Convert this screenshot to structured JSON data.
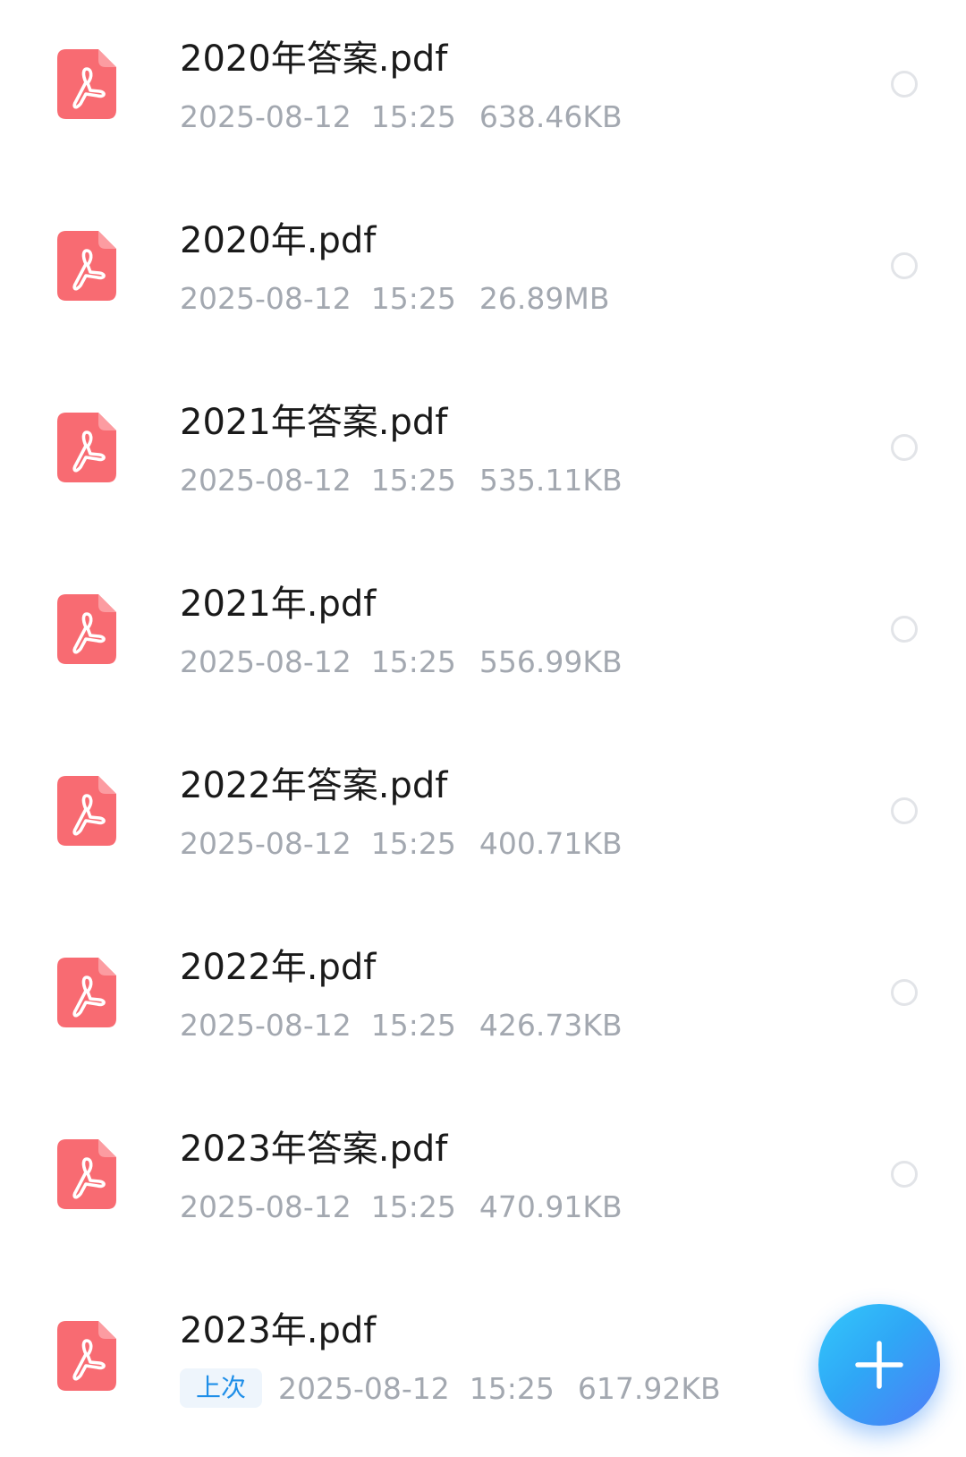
{
  "files": [
    {
      "name": "2020年答案.pdf",
      "date": "2025-08-12",
      "time": "15:25",
      "size": "638.46KB",
      "icon": "pdf-file-icon",
      "selected": false
    },
    {
      "name": "2020年.pdf",
      "date": "2025-08-12",
      "time": "15:25",
      "size": "26.89MB",
      "icon": "pdf-file-icon",
      "selected": false
    },
    {
      "name": "2021年答案.pdf",
      "date": "2025-08-12",
      "time": "15:25",
      "size": "535.11KB",
      "icon": "pdf-file-icon",
      "selected": false
    },
    {
      "name": "2021年.pdf",
      "date": "2025-08-12",
      "time": "15:25",
      "size": "556.99KB",
      "icon": "pdf-file-icon",
      "selected": false
    },
    {
      "name": "2022年答案.pdf",
      "date": "2025-08-12",
      "time": "15:25",
      "size": "400.71KB",
      "icon": "pdf-file-icon",
      "selected": false
    },
    {
      "name": "2022年.pdf",
      "date": "2025-08-12",
      "time": "15:25",
      "size": "426.73KB",
      "icon": "pdf-file-icon",
      "selected": false
    },
    {
      "name": "2023年答案.pdf",
      "date": "2025-08-12",
      "time": "15:25",
      "size": "470.91KB",
      "icon": "pdf-file-icon",
      "selected": false
    },
    {
      "name": "2023年.pdf",
      "badge": "上次",
      "date": "2025-08-12",
      "time": "15:25",
      "size": "617.92KB",
      "icon": "pdf-file-icon"
    }
  ],
  "fab": {
    "icon": "plus-icon"
  },
  "colors": {
    "pdf_icon": "#f86b72",
    "name_text": "#1a1a1a",
    "meta_text": "#a3a8b0",
    "badge_text": "#1e8ee8",
    "badge_bg": "#eef5fc",
    "radio_border": "#e2e4e8",
    "fab_gradient_start": "#33c8fb",
    "fab_gradient_end": "#4f7cf7"
  }
}
